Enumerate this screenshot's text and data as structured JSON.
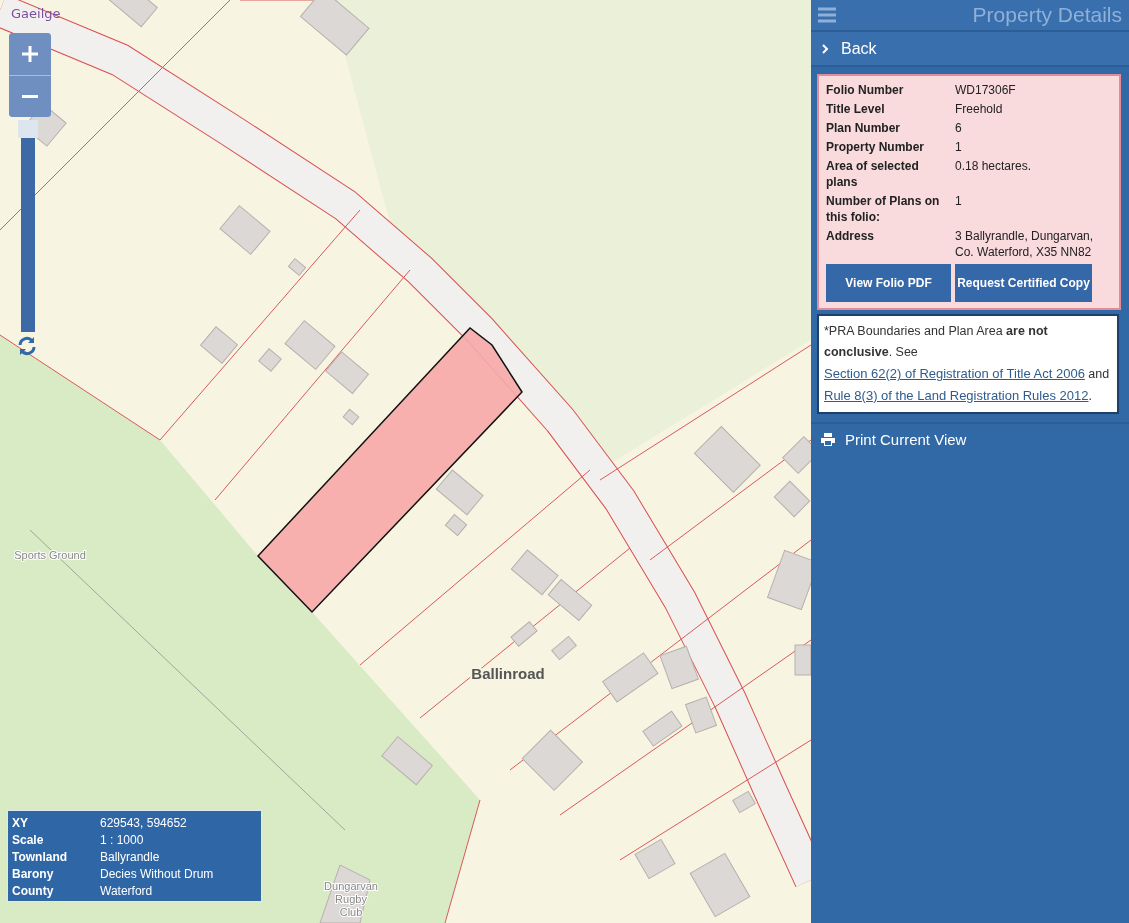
{
  "map": {
    "language_link": "Gaeilge",
    "zoom_slider": {
      "level": 1
    },
    "labels": [
      {
        "text": "Ballinroad",
        "kind": "place"
      },
      {
        "text": "Sports Ground",
        "kind": "feature"
      },
      {
        "text": "Dungarvan Rugby Club",
        "kind": "feature"
      }
    ],
    "info": [
      {
        "label": "XY",
        "value": "629543, 594652"
      },
      {
        "label": "Scale",
        "value": "1 : 1000"
      },
      {
        "label": "Townland",
        "value": "Ballyrandle"
      },
      {
        "label": "Barony",
        "value": "Decies Without Drum"
      },
      {
        "label": "County",
        "value": "Waterford"
      }
    ]
  },
  "sidebar": {
    "title": "Property Details",
    "back": "Back",
    "details": [
      {
        "label": "Folio Number",
        "value": "WD17306F"
      },
      {
        "label": "Title Level",
        "value": "Freehold"
      },
      {
        "label": "Plan Number",
        "value": "6"
      },
      {
        "label": "Property Number",
        "value": "1"
      },
      {
        "label": "Area of selected plans",
        "value": "0.18 hectares."
      },
      {
        "label": "Number of Plans on this folio:",
        "value": "1"
      },
      {
        "label": "Address",
        "value": "3 Ballyrandle, Dungarvan, Co. Waterford, X35 NN82"
      }
    ],
    "buttons": [
      "View Folio PDF",
      "Request Certified Copy"
    ],
    "disclaimer": [
      {
        "kind": "text",
        "text": " *PRA Boundaries and Plan Area **are not conclusive**. See "
      },
      {
        "kind": "link",
        "text": "Section 62(2) of Registration of Title Act 2006"
      },
      {
        "kind": "text",
        "text": " and "
      },
      {
        "kind": "link",
        "text": "Rule 8(3) of the Land Registration Rules 2012"
      },
      {
        "kind": "text",
        "text": "."
      }
    ],
    "print": "Print Current View"
  }
}
